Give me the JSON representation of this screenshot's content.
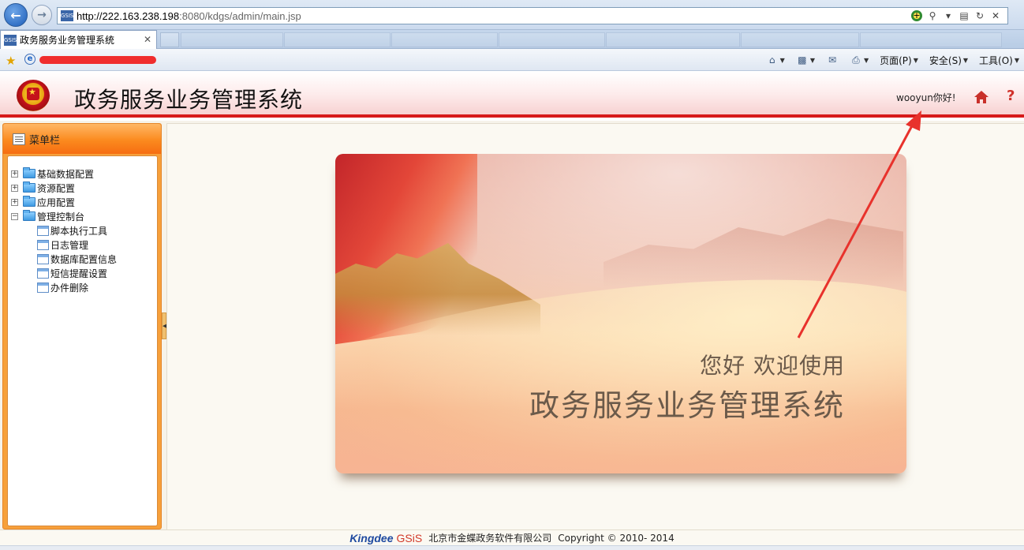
{
  "browser": {
    "url_host": "http://222.163.238.198",
    "url_rest": ":8080/kdgs/admin/main.jsp",
    "tab_title": "政务服务业务管理系统",
    "favicon_text": "GSIS",
    "commands": {
      "page": "页面(P)",
      "safety": "安全(S)",
      "tools": "工具(O)"
    }
  },
  "app": {
    "title": "政务服务业务管理系统",
    "greeting": "wooyun你好!",
    "help": "?"
  },
  "sidebar": {
    "title": "菜单栏",
    "folders": [
      {
        "label": "基础数据配置",
        "expander": "+"
      },
      {
        "label": "资源配置",
        "expander": "+"
      },
      {
        "label": "应用配置",
        "expander": "+"
      },
      {
        "label": "管理控制台",
        "expander": "−"
      }
    ],
    "children": [
      {
        "label": "脚本执行工具"
      },
      {
        "label": "日志管理"
      },
      {
        "label": "数据库配置信息"
      },
      {
        "label": "短信提醒设置"
      },
      {
        "label": "办件删除"
      }
    ]
  },
  "banner": {
    "welcome": "您好 欢迎使用",
    "system_name": "政务服务业务管理系统"
  },
  "footer": {
    "brand_a": "Kingdee",
    "brand_b": "GSiS",
    "company": "北京市金蝶政务软件有限公司",
    "copyright": "Copyright © 2010- 2014"
  },
  "colors": {
    "accent_red": "#d71a1a",
    "sidebar_orange": "#f7a03a",
    "annotation_red": "#e8322c"
  }
}
